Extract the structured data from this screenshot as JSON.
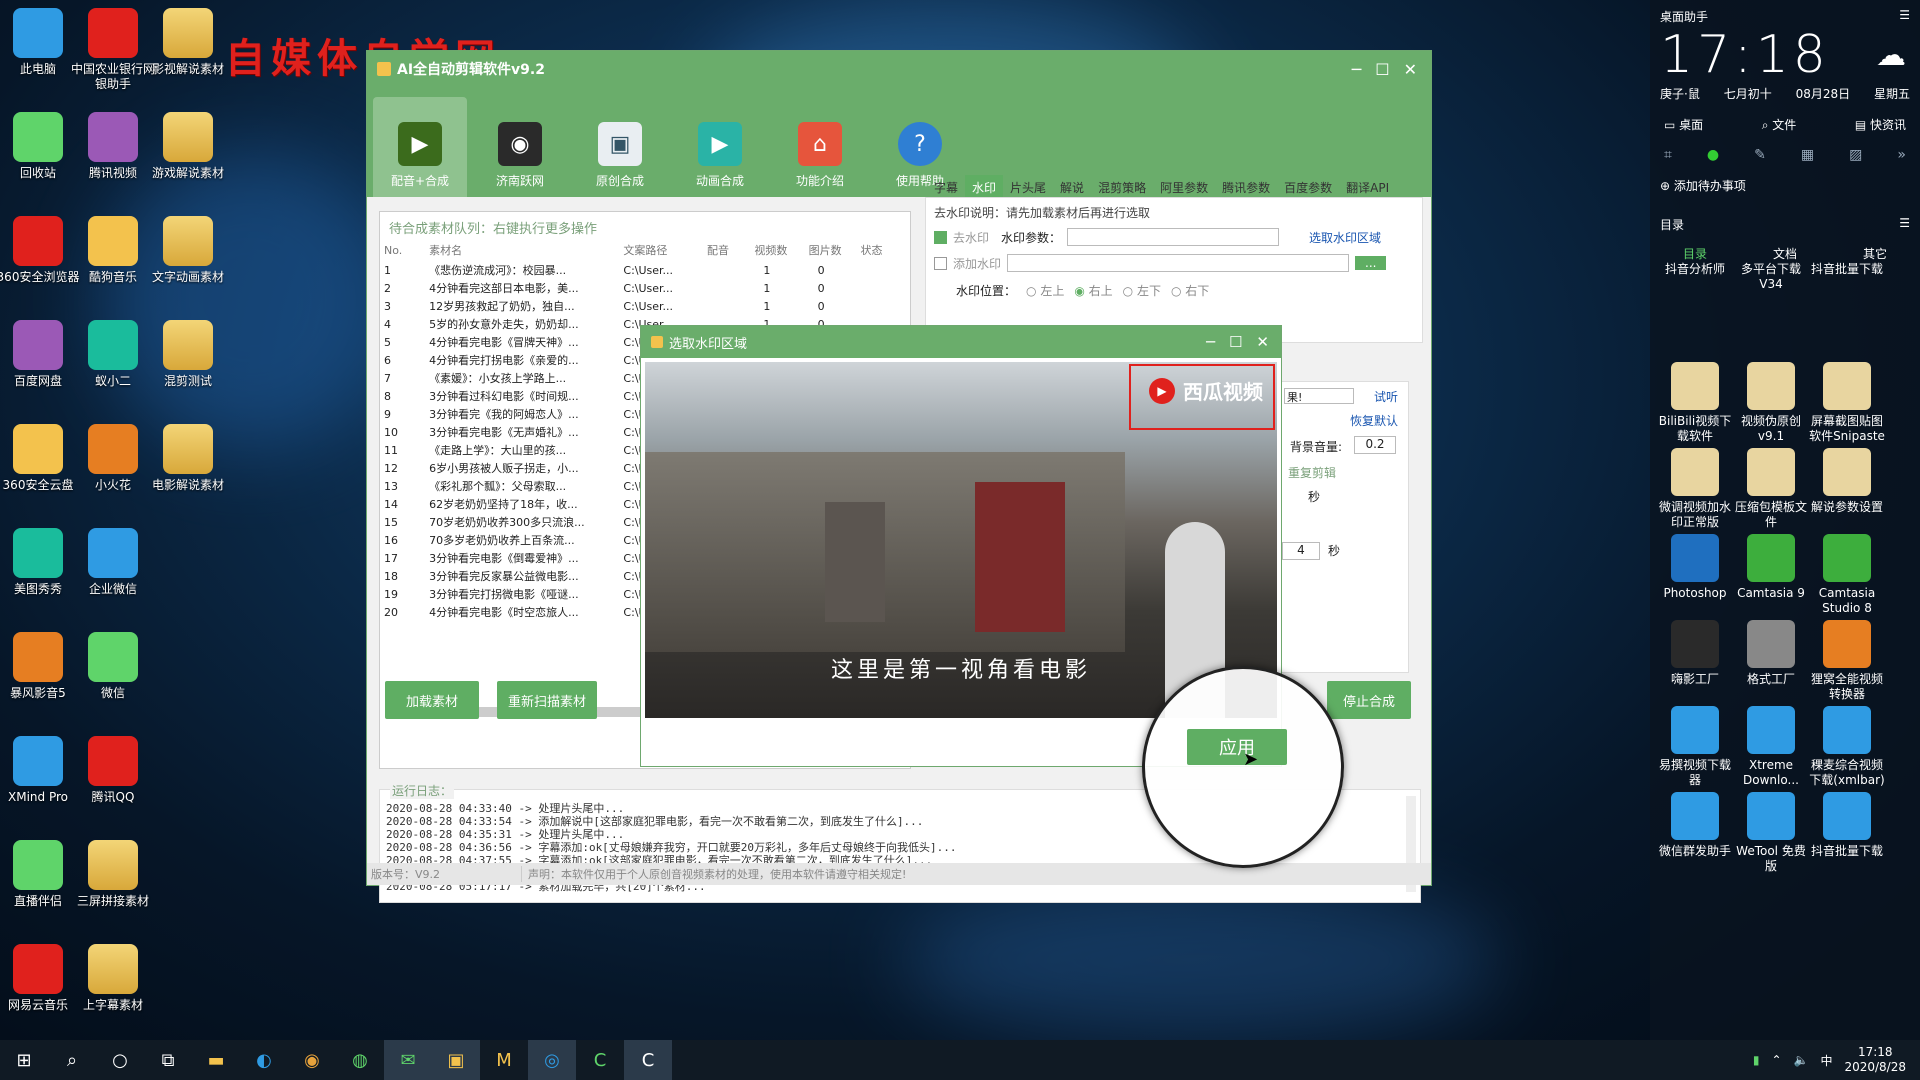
{
  "desktop": {
    "overlay_text": "自媒体自学网",
    "icons_col1": [
      "此电脑",
      "回收站",
      "360安全浏览器",
      "百度网盘",
      "360安全云盘",
      "美图秀秀",
      "暴风影音5",
      "XMind Pro",
      "直播伴侣",
      "网易云音乐"
    ],
    "icons_col2": [
      "中国农业银行网银助手",
      "腾讯视频",
      "酷狗音乐",
      "蚁小二",
      "小火花",
      "企业微信",
      "微信",
      "腾讯QQ",
      "三屏拼接素材",
      "上字幕素材"
    ],
    "icons_col3": [
      "影视解说素材",
      "游戏解说素材",
      "文字动画素材",
      "混剪测试",
      "电影解说素材"
    ]
  },
  "app": {
    "title": "AI全自动剪辑软件v9.2",
    "toolbar": [
      "配音+合成",
      "济南跃网",
      "原创合成",
      "动画合成",
      "功能介绍",
      "使用帮助"
    ],
    "queue_label": "待合成素材队列：右键执行更多操作",
    "columns": [
      "No.",
      "素材名",
      "文案路径",
      "配音",
      "视频数",
      "图片数",
      "状态"
    ],
    "rows": [
      [
        "1",
        "《悲伤逆流成河》：校园暴...",
        "C:\\User...",
        "",
        "1",
        "0"
      ],
      [
        "2",
        "4分钟看完这部日本电影，美...",
        "C:\\User...",
        "",
        "1",
        "0"
      ],
      [
        "3",
        "12岁男孩救起了奶奶，独自...",
        "C:\\User...",
        "",
        "1",
        "0"
      ],
      [
        "4",
        "5岁的孙女意外走失，奶奶却...",
        "C:\\User...",
        "",
        "1",
        "0"
      ],
      [
        "5",
        "4分钟看完电影《冒牌天神》...",
        "C:\\User...",
        "",
        "1",
        "0"
      ],
      [
        "6",
        "4分钟看完打拐电影《亲爱的...",
        "C:\\User...",
        "",
        "1",
        "0"
      ],
      [
        "7",
        "《素媛》：小女孩上学路上...",
        "C:\\User...",
        "",
        "1",
        "0"
      ],
      [
        "8",
        "3分钟看过科幻电影《时间规...",
        "C:\\Us",
        "",
        "",
        ""
      ],
      [
        "9",
        "3分钟看完《我的阿姆恋人》...",
        "C:\\Us",
        "",
        "",
        ""
      ],
      [
        "10",
        "3分钟看完电影《无声婚礼》...",
        "C:\\Us",
        "",
        "",
        ""
      ],
      [
        "11",
        "《走路上学》：大山里的孩...",
        "C:\\Us",
        "",
        "",
        ""
      ],
      [
        "12",
        "6岁小男孩被人贩子拐走，小...",
        "C:\\Us",
        "",
        "",
        ""
      ],
      [
        "13",
        "《彩礼那个瓢》：父母索取...",
        "C:\\Us",
        "",
        "",
        ""
      ],
      [
        "14",
        "62岁老奶奶坚持了18年，收...",
        "C:\\Us",
        "",
        "",
        ""
      ],
      [
        "15",
        "70岁老奶奶收养300多只流浪...",
        "C:\\Us",
        "",
        "",
        ""
      ],
      [
        "16",
        "70多岁老奶奶收养上百条流...",
        "C:\\Us",
        "",
        "",
        ""
      ],
      [
        "17",
        "3分钟看完电影《倒霉爱神》...",
        "C:\\Us",
        "",
        "",
        ""
      ],
      [
        "18",
        "3分钟看完反家暴公益微电影...",
        "C:\\Us",
        "",
        "",
        ""
      ],
      [
        "19",
        "3分钟看完打拐微电影《哑谜...",
        "C:\\Us",
        "",
        "",
        ""
      ],
      [
        "20",
        "4分钟看完电影《时空恋旅人...",
        "C:\\Us",
        "",
        "",
        ""
      ]
    ],
    "buttons": {
      "load": "加载素材",
      "rescan": "重新扫描素材",
      "stop": "停止合成"
    },
    "tabs": [
      "字幕",
      "水印",
      "片头尾",
      "解说",
      "混剪策略",
      "阿里参数",
      "腾讯参数",
      "百度参数",
      "翻译API"
    ],
    "active_tab": "水印",
    "watermark": {
      "hint": "去水印说明：请先加载素材后再进行选取",
      "remove_label": "去水印",
      "param_label": "水印参数：",
      "select_region": "选取水印区域",
      "add_label": "添加水印",
      "browse": "...",
      "position_label": "水印位置：",
      "positions": [
        "左上",
        "右上",
        "左下",
        "右下"
      ],
      "selected_position": "右上"
    },
    "right_misc": {
      "preview": "试听",
      "restore": "恢复默认",
      "bg_volume_label": "背景音量:",
      "bg_volume": "0.2",
      "unit_sec": "秒",
      "num4": "4",
      "repeat": "重复剪辑",
      "result_label": "果!"
    },
    "log_label": "运行日志：",
    "log_lines": [
      "2020-08-28 04:33:40 -> 处理片头尾中...",
      "2020-08-28 04:33:54 -> 添加解说中[这部家庭犯罪电影，看完一次不敢看第二次，到底发生了什么]...",
      "2020-08-28 04:35:31 -> 处理片头尾中...",
      "2020-08-28 04:36:56 -> 字幕添加:ok[丈母娘嫌弃我穷，开口就要20万彩礼，多年后丈母娘终于向我低头]...",
      "2020-08-28 04:37:55 -> 字幕添加:ok[这部家庭犯罪电影，看完一次不敢看第二次，到底发生了什么]...",
      "2020-08-28 04:37:56 -> 全部任务合成完毕...",
      "2020-08-28 05:17:17 -> 素材加载完毕，共[20]个素材..."
    ],
    "status_version": "版本号：V9.2",
    "status_notice": "声明：本软件仅用于个人原创音视频素材的处理，使用本软件请遵守相关规定!"
  },
  "dialog": {
    "title": "选取水印区域",
    "watermark_logo": "西瓜视频",
    "subtitle": "这里是第一视角看电影",
    "apply": "应用"
  },
  "sidebar": {
    "title": "桌面助手",
    "time": "17:18",
    "lunar_year": "庚子·鼠",
    "lunar_date": "七月初十",
    "date": "08月28日",
    "weekday": "星期五",
    "quick": [
      "桌面",
      "文件",
      "快资讯"
    ],
    "todo": "添加待办事项",
    "catalog": "目录",
    "cat_tabs": [
      "目录",
      "文档",
      "其它"
    ],
    "items": [
      "抖音分析师",
      "多平台下载V34",
      "抖音批量下载",
      "BiliBili视频下载软件",
      "视频伪原创v9.1",
      "屏幕截图贴图软件Snipaste",
      "微调视频加水印正常版",
      "压缩包模板文件",
      "解说参数设置",
      "Photoshop",
      "Camtasia 9",
      "Camtasia Studio 8",
      "嗨影工厂",
      "格式工厂",
      "狸窝全能视频转换器",
      "易撰视频下载器",
      "Xtreme Downlo...",
      "稞麦综合视频下载(xmlbar)",
      "微信群发助手",
      "WeTool 免费版",
      "抖音批量下载"
    ]
  },
  "taskbar": {
    "time": "17:18",
    "date": "2020/8/28",
    "ime": "中"
  }
}
